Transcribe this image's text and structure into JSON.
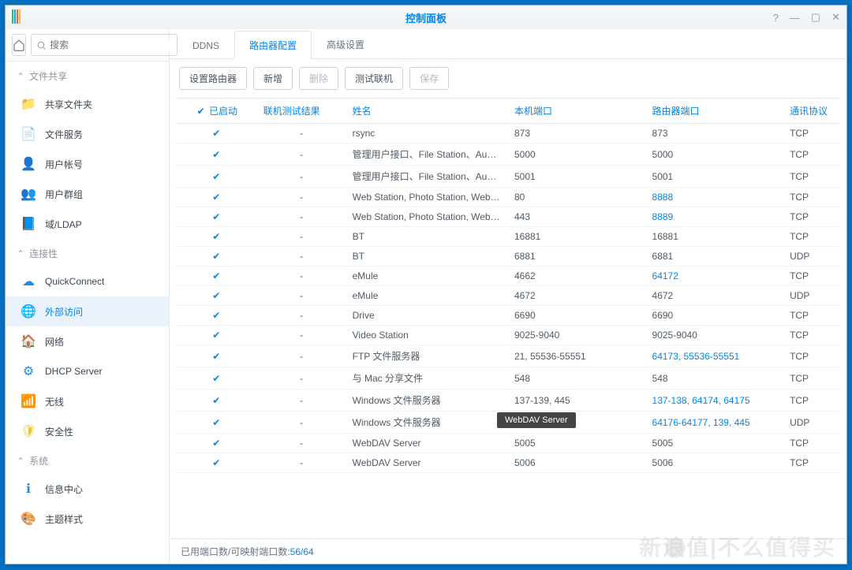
{
  "window": {
    "title": "控制面板"
  },
  "search": {
    "placeholder": "搜索"
  },
  "sidebar": {
    "groups": [
      {
        "label": "文件共享",
        "items": [
          {
            "label": "共享文件夹",
            "iconColor": "#2db56a"
          },
          {
            "label": "文件服务",
            "iconColor": "#2db56a"
          },
          {
            "label": "用户帐号",
            "iconColor": "#e86b5a"
          },
          {
            "label": "用户群组",
            "iconColor": "#e86b5a"
          },
          {
            "label": "域/LDAP",
            "iconColor": "#1f8fe6"
          }
        ]
      },
      {
        "label": "连接性",
        "items": [
          {
            "label": "QuickConnect",
            "iconColor": "#1f8fe6"
          },
          {
            "label": "外部访问",
            "iconColor": "#1f8fe6",
            "active": true
          },
          {
            "label": "网络",
            "iconColor": "#e86b5a"
          },
          {
            "label": "DHCP Server",
            "iconColor": "#1f8fe6"
          },
          {
            "label": "无线",
            "iconColor": "#8a9aa8"
          },
          {
            "label": "安全性",
            "iconColor": "#f0c330"
          }
        ]
      },
      {
        "label": "系统",
        "items": [
          {
            "label": "信息中心",
            "iconColor": "#1f8fe6"
          },
          {
            "label": "主题样式",
            "iconColor": "#2db56a"
          }
        ]
      }
    ]
  },
  "tabs": [
    {
      "label": "DDNS"
    },
    {
      "label": "路由器配置",
      "active": true
    },
    {
      "label": "高级设置"
    }
  ],
  "toolbar": {
    "setup": "设置路由器",
    "add": "新增",
    "del": "删除",
    "test": "测试联机",
    "save": "保存"
  },
  "table": {
    "headers": {
      "enabled": "已启动",
      "testresult": "联机测试结果",
      "name": "姓名",
      "localport": "本机端口",
      "routerport": "路由器端口",
      "protocol": "通讯协议"
    },
    "rows": [
      {
        "enabled": true,
        "test": "-",
        "name": "rsync",
        "local": "873",
        "router": "873",
        "routerLink": false,
        "proto": "TCP"
      },
      {
        "enabled": true,
        "test": "-",
        "name": "管理用户接口、File Station、Audio S...",
        "local": "5000",
        "router": "5000",
        "routerLink": false,
        "proto": "TCP"
      },
      {
        "enabled": true,
        "test": "-",
        "name": "管理用户接口、File Station、Audio S...",
        "local": "5001",
        "router": "5001",
        "routerLink": false,
        "proto": "TCP"
      },
      {
        "enabled": true,
        "test": "-",
        "name": "Web Station, Photo Station, Web M...",
        "local": "80",
        "router": "8888",
        "routerLink": true,
        "proto": "TCP"
      },
      {
        "enabled": true,
        "test": "-",
        "name": "Web Station, Photo Station, Web M...",
        "local": "443",
        "router": "8889",
        "routerLink": true,
        "proto": "TCP"
      },
      {
        "enabled": true,
        "test": "-",
        "name": "BT",
        "local": "16881",
        "router": "16881",
        "routerLink": false,
        "proto": "TCP"
      },
      {
        "enabled": true,
        "test": "-",
        "name": "BT",
        "local": "6881",
        "router": "6881",
        "routerLink": false,
        "proto": "UDP"
      },
      {
        "enabled": true,
        "test": "-",
        "name": "eMule",
        "local": "4662",
        "router": "64172",
        "routerLink": true,
        "proto": "TCP"
      },
      {
        "enabled": true,
        "test": "-",
        "name": "eMule",
        "local": "4672",
        "router": "4672",
        "routerLink": false,
        "proto": "UDP"
      },
      {
        "enabled": true,
        "test": "-",
        "name": "Drive",
        "local": "6690",
        "router": "6690",
        "routerLink": false,
        "proto": "TCP"
      },
      {
        "enabled": true,
        "test": "-",
        "name": "Video Station",
        "local": "9025-9040",
        "router": "9025-9040",
        "routerLink": false,
        "proto": "TCP"
      },
      {
        "enabled": true,
        "test": "-",
        "name": "FTP 文件服务器",
        "local": "21, 55536-55551",
        "router": "64173, 55536-55551",
        "routerLink": true,
        "proto": "TCP"
      },
      {
        "enabled": true,
        "test": "-",
        "name": "与 Mac 分享文件",
        "local": "548",
        "router": "548",
        "routerLink": false,
        "proto": "TCP"
      },
      {
        "enabled": true,
        "test": "-",
        "name": "Windows 文件服务器",
        "local": "137-139, 445",
        "router": "137-138, 64174, 64175",
        "routerLink": true,
        "proto": "TCP"
      },
      {
        "enabled": true,
        "test": "-",
        "name": "Windows 文件服务器",
        "local": "137-139, 445",
        "router": "64176-64177, 139, 445",
        "routerLink": true,
        "proto": "UDP"
      },
      {
        "enabled": true,
        "test": "-",
        "name": "WebDAV Server",
        "local": "5005",
        "router": "5005",
        "routerLink": false,
        "proto": "TCP"
      },
      {
        "enabled": true,
        "test": "-",
        "name": "WebDAV Server",
        "local": "5006",
        "router": "5006",
        "routerLink": false,
        "proto": "TCP"
      }
    ]
  },
  "tooltip": "WebDAV Server",
  "status": {
    "prefix": "已用端口数/可映射端口数: ",
    "value": "56/64"
  },
  "watermark": "新浪值|不么值得买"
}
